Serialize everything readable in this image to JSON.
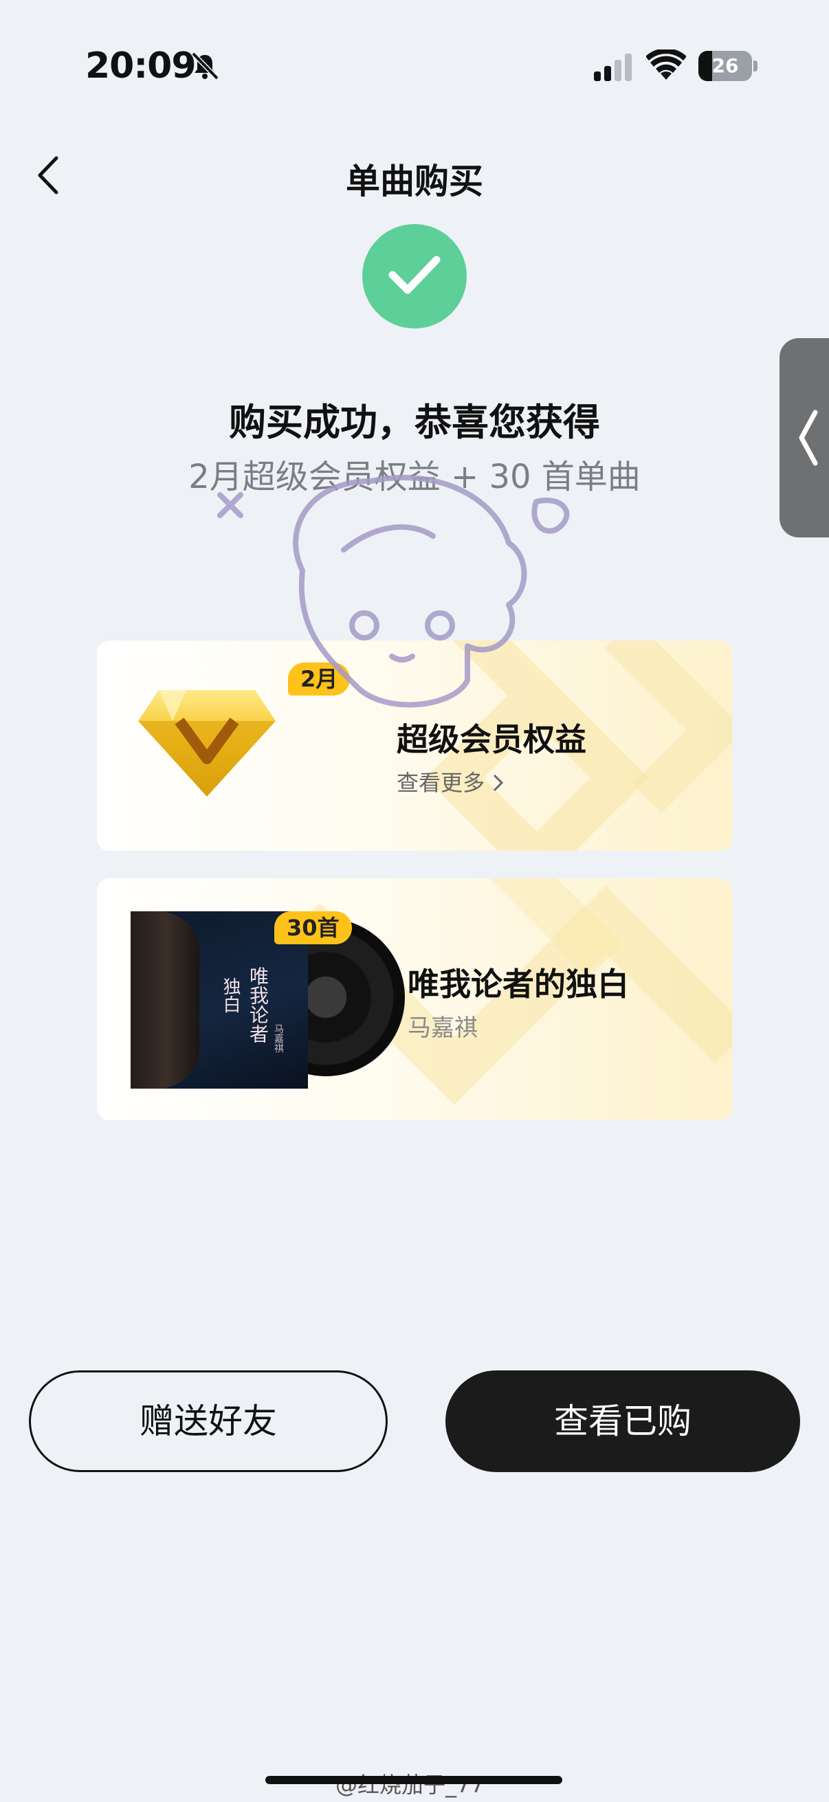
{
  "status_bar": {
    "time": "20:09",
    "battery_level": "26",
    "battery_fraction": 0.26
  },
  "nav": {
    "title": "单曲购买"
  },
  "result": {
    "title": "购买成功，恭喜您获得",
    "subtitle": "2月超级会员权益 + 30 首单曲"
  },
  "vip_card": {
    "badge": "2月",
    "title": "超级会员权益",
    "more_label": "查看更多",
    "icon": "diamond-icon"
  },
  "song_card": {
    "badge": "30首",
    "title": "唯我论者的独白",
    "artist": "马嘉祺",
    "cover_text_title": "唯我论者",
    "cover_text_sub": "独白",
    "cover_text_artist": "马嘉祺"
  },
  "actions": {
    "gift_label": "赠送好友",
    "view_label": "查看已购"
  },
  "watermark": {
    "text": "@红烧茄子_77",
    "drawn_text": "红烧茄子_77"
  },
  "colors": {
    "accent_green": "#5dcf98",
    "badge_yellow": "#ffc21a",
    "button_dark": "#1b1b1b",
    "background": "#eef2f6"
  }
}
